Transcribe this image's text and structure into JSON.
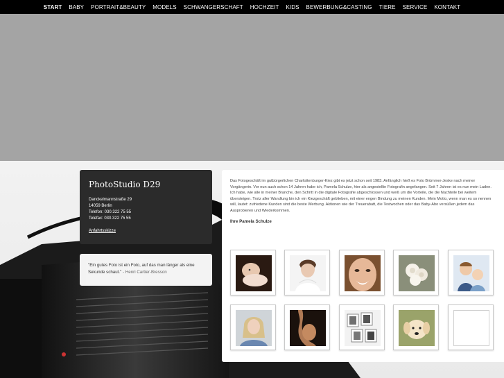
{
  "nav": {
    "items": [
      {
        "label": "START",
        "active": true
      },
      {
        "label": "BABY"
      },
      {
        "label": "PORTRAIT&BEAUTY"
      },
      {
        "label": "MODELS"
      },
      {
        "label": "SCHWANGERSCHAFT"
      },
      {
        "label": "HOCHZEIT"
      },
      {
        "label": "KIDS"
      },
      {
        "label": "BEWERBUNG&CASTING"
      },
      {
        "label": "TIERE"
      },
      {
        "label": "SERVICE"
      },
      {
        "label": "KONTAKT"
      }
    ]
  },
  "info": {
    "title": "PhotoStudio D29",
    "street": "Danckelmannstraße 29",
    "city": "14059 Berlin",
    "phone": "Telefon: 030.322 75 55",
    "fax": "Telefax: 030.322 75 55",
    "directions_link": "Anfahrtsskizze"
  },
  "quote": {
    "text": "\"Ein gutes Foto ist ein Foto, auf das man länger als eine Sekunde schaut.\"",
    "author": "- Henri Cartier-Bresson"
  },
  "content": {
    "body": "Das Fotogeschäft im gutbürgerlichen Charlottenburger-Kiez gibt es jetzt schon seit 1983. Anfänglich hieß es Foto Brümmer-Jeske nach meiner Vorgängerin. Vor nun auch schon 14 Jahren habe ich, Pamela Schulze, hier als angestellte Fotografin angefangen. Seit 7 Jahren ist es nun mein Laden. Ich habe, wie alle in meiner Branche, den Schritt in die digitale Fotografie abgeschlossen und weiß um die Vorteile, die die Nachteile bei weitem übersteigen. Trotz aller Wandlung bin ich ein Kiezgeschäft geblieben, mit einer engen Bindung zu meinen Kunden. Mein Motto, wenn man es so nennen will, lautet: zufriedene Kunden sind die beste Werbung. Aktionen wie der Treuerabatt, die Testwochen oder das Baby-Abo versüßen jedem das Ausprobieren und Wiederkommen.",
    "signature": "Ihre Pamela Schulze"
  },
  "thumbnails": [
    {
      "subject": "baby-photo"
    },
    {
      "subject": "portrait-woman-white"
    },
    {
      "subject": "beauty-face-closeup"
    },
    {
      "subject": "wedding-roses"
    },
    {
      "subject": "kids-siblings"
    },
    {
      "subject": "model-blonde-woman"
    },
    {
      "subject": "pregnancy-belly"
    },
    {
      "subject": "passport-photos"
    },
    {
      "subject": "puppy-dog"
    },
    {
      "subject": "empty-frame"
    }
  ],
  "colors": {
    "nav_bg": "#000000",
    "banner_bg": "#a4a4a4",
    "info_bg": "#2b2b2b"
  }
}
